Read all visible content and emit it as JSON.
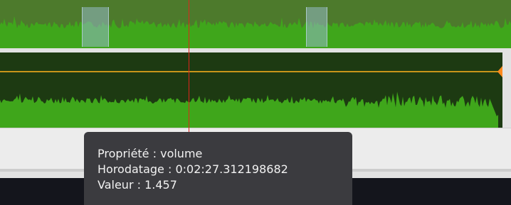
{
  "tooltip": {
    "property_label": "Propriété",
    "property_value": "volume",
    "timestamp_label": "Horodatage",
    "timestamp_value": "0:02:27.312198682",
    "value_label": "Valeur",
    "value_value": "1.457"
  },
  "colors": {
    "overview_bg": "#4d7a2c",
    "waveform": "#3fa61b",
    "clip_bg": "#1d3a12",
    "keyframe_line": "#c8951a",
    "keyframe_marker": "#ff8a1e",
    "playhead": "#e0241c",
    "selection_band": "#96b9c8",
    "tooltip_bg": "#3b3b3f"
  },
  "icons": {
    "keyframe": "keyframe-diamond-icon"
  }
}
